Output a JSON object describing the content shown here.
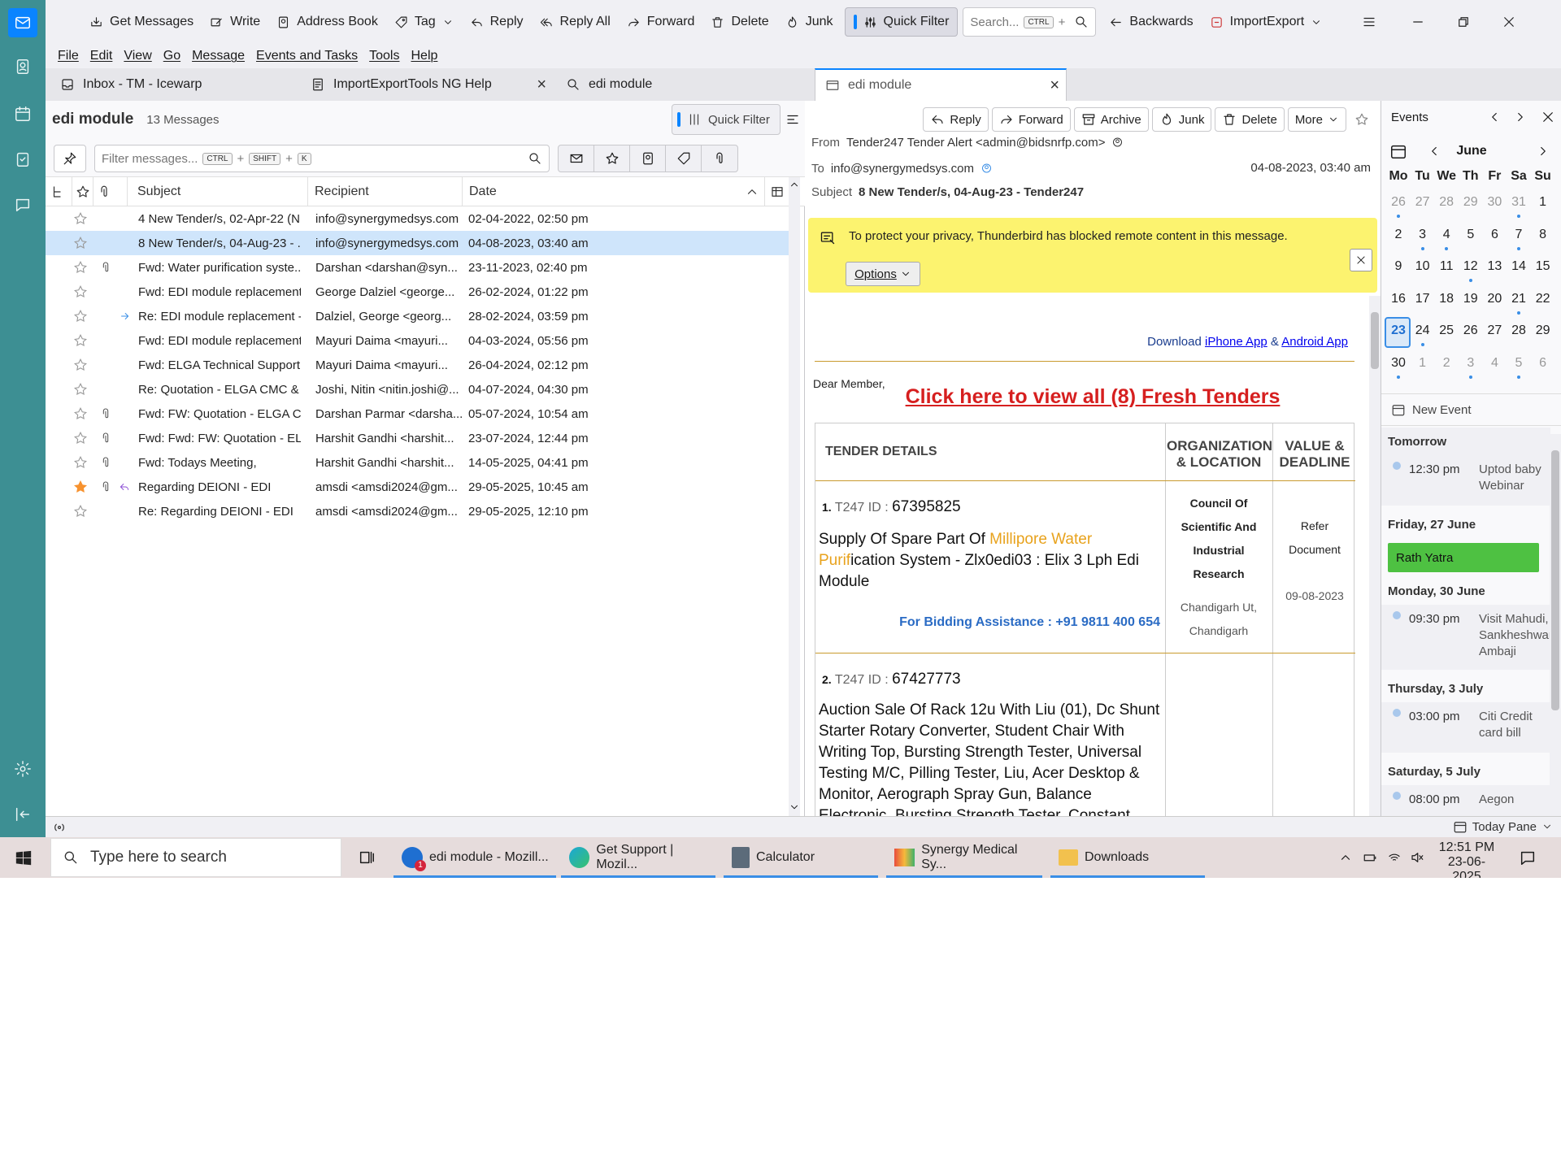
{
  "toolbar": {
    "get_messages": "Get Messages",
    "write": "Write",
    "address_book": "Address Book",
    "tag": "Tag",
    "reply": "Reply",
    "reply_all": "Reply All",
    "forward": "Forward",
    "delete": "Delete",
    "junk": "Junk",
    "quick_filter": "Quick Filter",
    "search_placeholder": "Search...",
    "search_kbd": "CTRL",
    "search_plus": "+",
    "backwards": "Backwards",
    "importexport": "ImportExport"
  },
  "menu": [
    "File",
    "Edit",
    "View",
    "Go",
    "Message",
    "Events and Tasks",
    "Tools",
    "Help"
  ],
  "tabs": [
    "Inbox - TM - Icewarp",
    "ImportExportTools NG Help",
    "edi module",
    "edi module"
  ],
  "list": {
    "folder": "edi module",
    "count": "13 Messages",
    "quick_filter": "Quick Filter",
    "filter_placeholder": "Filter messages...",
    "kbd1": "CTRL",
    "kbd2": "SHIFT",
    "kbd3": "K",
    "plus": "+",
    "columns": {
      "subject": "Subject",
      "recipient": "Recipient",
      "date": "Date"
    },
    "rows": [
      {
        "subject": "4 New Tender/s, 02-Apr-22 (N...",
        "recipient": "info@synergymedsys.com",
        "date": "02-04-2022, 02:50 pm",
        "attach": false,
        "starred": false,
        "status": ""
      },
      {
        "subject": "8 New Tender/s, 04-Aug-23 - ...",
        "recipient": "info@synergymedsys.com",
        "date": "04-08-2023, 03:40 am",
        "attach": false,
        "starred": false,
        "status": ""
      },
      {
        "subject": "Fwd: Water purification syste...",
        "recipient": "Darshan <darshan@syn...",
        "date": "23-11-2023, 02:40 pm",
        "attach": true,
        "starred": false,
        "status": ""
      },
      {
        "subject": "Fwd: EDI module replacement...",
        "recipient": "George Dalziel <george...",
        "date": "26-02-2024, 01:22 pm",
        "attach": false,
        "starred": false,
        "status": ""
      },
      {
        "subject": "Re: EDI module replacement -...",
        "recipient": "Dalziel, George <georg...",
        "date": "28-02-2024, 03:59 pm",
        "attach": false,
        "starred": false,
        "status": "forwarded"
      },
      {
        "subject": "Fwd: EDI module replacement...",
        "recipient": "Mayuri Daima <mayuri...",
        "date": "04-03-2024, 05:56 pm",
        "attach": false,
        "starred": false,
        "status": ""
      },
      {
        "subject": "Fwd: ELGA Technical Support ...",
        "recipient": "Mayuri Daima <mayuri...",
        "date": "26-04-2024, 02:12 pm",
        "attach": false,
        "starred": false,
        "status": ""
      },
      {
        "subject": "Re: Quotation - ELGA CMC & ...",
        "recipient": "Joshi, Nitin <nitin.joshi@...",
        "date": "04-07-2024, 04:30 pm",
        "attach": false,
        "starred": false,
        "status": ""
      },
      {
        "subject": "Fwd: FW: Quotation - ELGA C...",
        "recipient": "Darshan Parmar <darsha...",
        "date": "05-07-2024, 10:54 am",
        "attach": true,
        "starred": false,
        "status": ""
      },
      {
        "subject": "Fwd: Fwd: FW: Quotation - EL...",
        "recipient": "Harshit Gandhi <harshit...",
        "date": "23-07-2024, 12:44 pm",
        "attach": true,
        "starred": false,
        "status": ""
      },
      {
        "subject": "Fwd: Todays Meeting,",
        "recipient": "Harshit Gandhi <harshit...",
        "date": "14-05-2025, 04:41 pm",
        "attach": true,
        "starred": false,
        "status": ""
      },
      {
        "subject": "Regarding DEIONI - EDI",
        "recipient": "amsdi <amsdi2024@gm...",
        "date": "29-05-2025, 10:45 am",
        "attach": true,
        "starred": true,
        "status": "replied"
      },
      {
        "subject": "Re: Regarding DEIONI - EDI",
        "recipient": "amsdi <amsdi2024@gm...",
        "date": "29-05-2025, 12:10 pm",
        "attach": false,
        "starred": false,
        "status": ""
      }
    ]
  },
  "message": {
    "buttons": {
      "reply": "Reply",
      "forward": "Forward",
      "archive": "Archive",
      "junk": "Junk",
      "delete": "Delete",
      "more": "More"
    },
    "from_label": "From",
    "from": "Tender247 Tender Alert <admin@bidsnrfp.com>",
    "to_label": "To",
    "to": "info@synergymedsys.com",
    "date": "04-08-2023, 03:40 am",
    "subject_label": "Subject",
    "subject": "8 New Tender/s, 04-Aug-23 - Tender247",
    "notice": "To protect your privacy, Thunderbird has blocked remote content in this message.",
    "options": "Options",
    "body": {
      "download_prefix": "Download ",
      "iphone": "iPhone App",
      "amp": " & ",
      "android": "Android App",
      "dear": "Dear Member,",
      "cta": "Click here to view all (8) Fresh Tenders",
      "th_details": "TENDER DETAILS",
      "th_org": "ORGANIZATION & LOCATION",
      "th_value": "VALUE & DEADLINE",
      "t1_num": "1.",
      "t1_label": "T247 ID : ",
      "t1_id": "67395825",
      "t1_pre": "Supply Of Spare Part Of ",
      "t1_hl1": "Millipore Water",
      "t1_hl2": "Purif",
      "t1_post": "ication System - Zlx0edi03 : Elix 3 Lph Edi Module",
      "t1_bid": "For Bidding Assistance : +91 9811 400 654",
      "t1_org": "Council Of Scientific And Industrial Research",
      "t1_loc": "Chandigarh Ut, Chandigarh",
      "t1_value": "Refer Document",
      "t1_deadline": "09-08-2023",
      "t2_num": "2.",
      "t2_label": "T247 ID : ",
      "t2_id": "67427773",
      "t2_desc": "Auction Sale Of Rack 12u With Liu (01), Dc Shunt Starter Rotary Converter, Student Chair With Writing Top, Bursting Strength Tester, Universal Testing M/C, Pilling Tester, Liu, Acer Desktop & Monitor, Aerograph Spray Gun, Balance Electronic, Bursting Strength Tester, Constant"
    }
  },
  "calendar": {
    "title": "Events",
    "month": "June",
    "days": [
      "Mo",
      "Tu",
      "We",
      "Th",
      "Fr",
      "Sa",
      "Su"
    ],
    "weeks": [
      [
        "26",
        "27",
        "28",
        "29",
        "30",
        "31",
        "1"
      ],
      [
        "2",
        "3",
        "4",
        "5",
        "6",
        "7",
        "8"
      ],
      [
        "9",
        "10",
        "11",
        "12",
        "13",
        "14",
        "15"
      ],
      [
        "16",
        "17",
        "18",
        "19",
        "20",
        "21",
        "22"
      ],
      [
        "23",
        "24",
        "25",
        "26",
        "27",
        "28",
        "29"
      ],
      [
        "30",
        "1",
        "2",
        "3",
        "4",
        "5",
        "6"
      ]
    ],
    "new_event": "New Event",
    "agenda": [
      {
        "header": "Tomorrow",
        "time": "12:30 pm",
        "title": "Uptod baby Webinar"
      },
      {
        "header": "Friday, 27 June",
        "allday": "Rath Yatra"
      },
      {
        "header": "Monday, 30 June",
        "time": "09:30 pm",
        "title": "Visit Mahudi, Sankheshwar, Ambaji"
      },
      {
        "header": "Thursday, 3 July",
        "time": "03:00 pm",
        "title": "Citi Credit card bill"
      },
      {
        "header": "Saturday, 5 July",
        "time": "08:00 pm",
        "title": "Aegon"
      }
    ]
  },
  "status": {
    "today_pane": "Today Pane"
  },
  "taskbar": {
    "search": "Type here to search",
    "apps": [
      "edi module - Mozill...",
      "Get Support | Mozil...",
      "Calculator",
      "Synergy Medical Sy...",
      "Downloads"
    ],
    "badge": "1",
    "time": "12:51 PM",
    "date": "23-06-2025"
  },
  "colors": {
    "accent": "#0a84ff",
    "spaces": "#3d8f93",
    "notice": "#fcf36f",
    "cta": "#d61f1f",
    "event_green": "#4ec142",
    "selected_row": "#cfe5fb"
  }
}
